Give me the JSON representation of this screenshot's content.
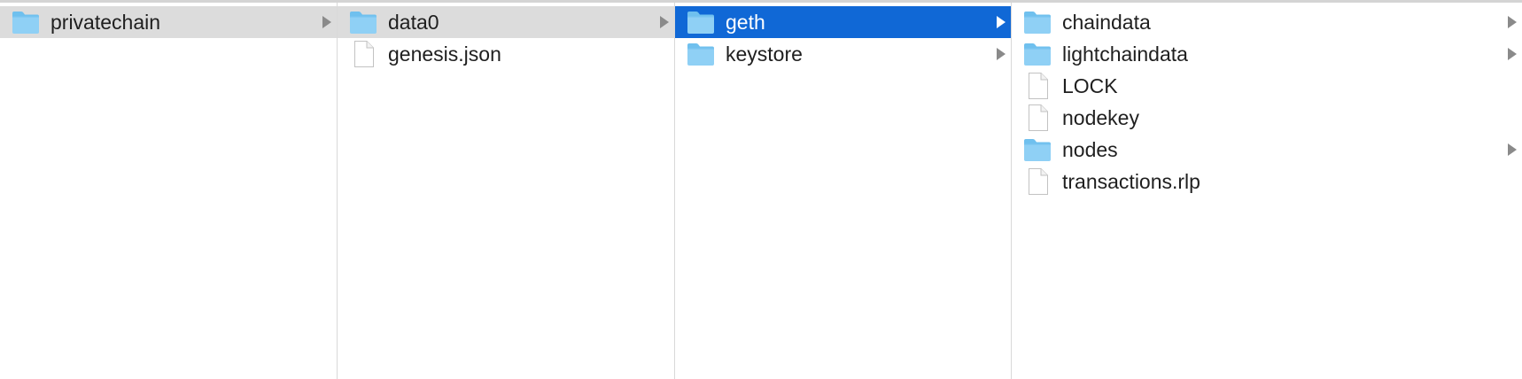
{
  "columns": [
    {
      "items": [
        {
          "label": "privatechain",
          "type": "folder",
          "state": "path",
          "has_children": true
        }
      ]
    },
    {
      "items": [
        {
          "label": "data0",
          "type": "folder",
          "state": "path",
          "has_children": true
        },
        {
          "label": "genesis.json",
          "type": "file",
          "state": "none",
          "has_children": false
        }
      ]
    },
    {
      "items": [
        {
          "label": "geth",
          "type": "folder",
          "state": "selected",
          "has_children": true
        },
        {
          "label": "keystore",
          "type": "folder",
          "state": "none",
          "has_children": true
        }
      ]
    },
    {
      "items": [
        {
          "label": "chaindata",
          "type": "folder",
          "state": "none",
          "has_children": true
        },
        {
          "label": "lightchaindata",
          "type": "folder",
          "state": "none",
          "has_children": true
        },
        {
          "label": "LOCK",
          "type": "file",
          "state": "none",
          "has_children": false
        },
        {
          "label": "nodekey",
          "type": "file",
          "state": "none",
          "has_children": false
        },
        {
          "label": "nodes",
          "type": "folder",
          "state": "none",
          "has_children": true
        },
        {
          "label": "transactions.rlp",
          "type": "file",
          "state": "none",
          "has_children": false
        }
      ]
    }
  ],
  "colors": {
    "selected": "#1068d6",
    "path": "#dcdcdc",
    "folder_body": "#8fd0f5",
    "folder_tab": "#6fc0ee",
    "chevron": "#8a8a8a",
    "chevron_selected": "#ffffff"
  }
}
